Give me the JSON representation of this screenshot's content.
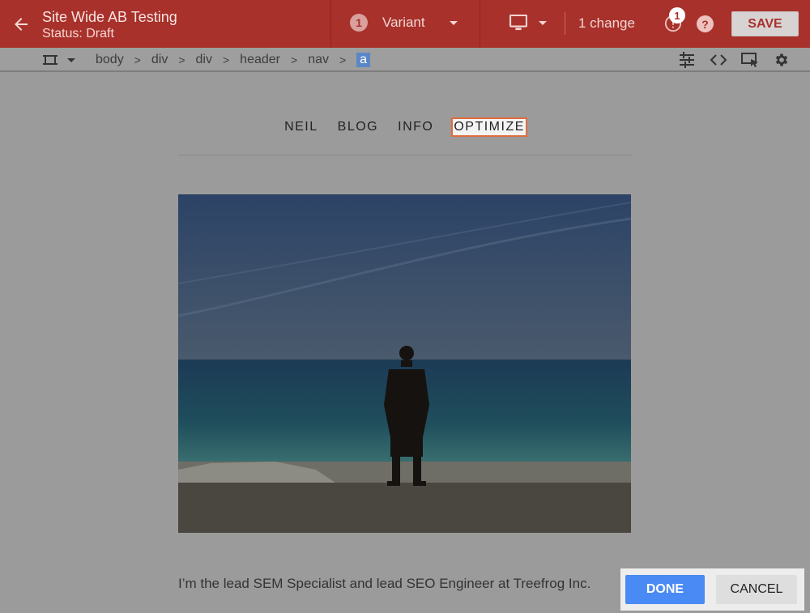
{
  "app": {
    "experiment_title": "Site Wide AB Testing",
    "status": "Status: Draft",
    "variant_number": "1",
    "variant_label": "Variant",
    "changes_label": "1 change",
    "alert_count": "1",
    "help_glyph": "?",
    "save_label": "SAVE",
    "accent_color": "#a8312b"
  },
  "breadcrumb": {
    "items": [
      "body",
      "div",
      "div",
      "header",
      "nav",
      "a"
    ],
    "separator": ">"
  },
  "tools": [
    "adjust-icon",
    "code-icon",
    "select-element-icon",
    "gear-icon"
  ],
  "site": {
    "nav": [
      "NEIL",
      "BLOG",
      "INFO",
      "OPTIMIZE"
    ],
    "bio": "I’m the lead SEM Specialist and lead SEO Engineer at Treefrog Inc."
  },
  "actions": {
    "done_label": "DONE",
    "cancel_label": "CANCEL"
  }
}
